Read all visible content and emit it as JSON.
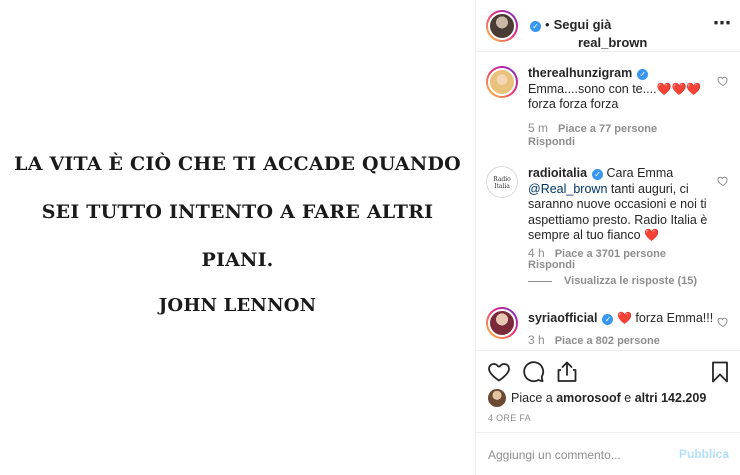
{
  "post": {
    "quote_lines": [
      "LA VITA È CIÒ CHE TI ACCADE QUANDO",
      "SEI TUTTO INTENTO A FARE ALTRI",
      "PIANI.",
      "JOHN LENNON"
    ]
  },
  "header": {
    "username": "real_brown",
    "verified": true,
    "dot": "•",
    "follow_label": "Segui già",
    "more_icon": "more-horizontal-icon"
  },
  "comments": [
    {
      "username": "therealhunzigram",
      "verified": true,
      "text": "Emma....sono con te....",
      "hearts": "❤️❤️❤️",
      "text2": "forza forza forza",
      "time": "5 m",
      "likes": "Piace a 77 persone",
      "reply": "Rispondi"
    },
    {
      "username": "radioitalia",
      "verified": true,
      "text_prefix": "Cara Emma",
      "mention": "@Real_brown",
      "text": "tanti auguri, ci saranno nuove occasioni e noi ti aspettiamo presto. Radio Italia è sempre al tuo fianco",
      "hearts": "❤️",
      "time": "4 h",
      "likes": "Piace a 3701 persone",
      "reply": "Rispondi",
      "view_replies": "Visualizza le risposte (15)"
    },
    {
      "username": "syriaofficial",
      "verified": true,
      "hearts": "❤️",
      "text": "forza Emma!!!",
      "time": "3 h",
      "likes": "Piace a 802 persone"
    }
  ],
  "actions": {
    "like_icon": "heart-outline-icon",
    "comment_icon": "comment-icon",
    "share_icon": "share-icon",
    "save_icon": "bookmark-icon"
  },
  "likes_summary": {
    "prefix": "Piace a",
    "user": "amorosoof",
    "conj": "e",
    "others": "altri 142.209"
  },
  "timestamp": "4 ORE FA",
  "comment_box": {
    "placeholder": "Aggiungi un commento...",
    "post_label": "Pubblica"
  },
  "colors": {
    "accent_blue": "#3897f0",
    "heart_red": "#ed1c24",
    "muted": "#8e8e8e",
    "post_disabled": "#b2dffc"
  }
}
